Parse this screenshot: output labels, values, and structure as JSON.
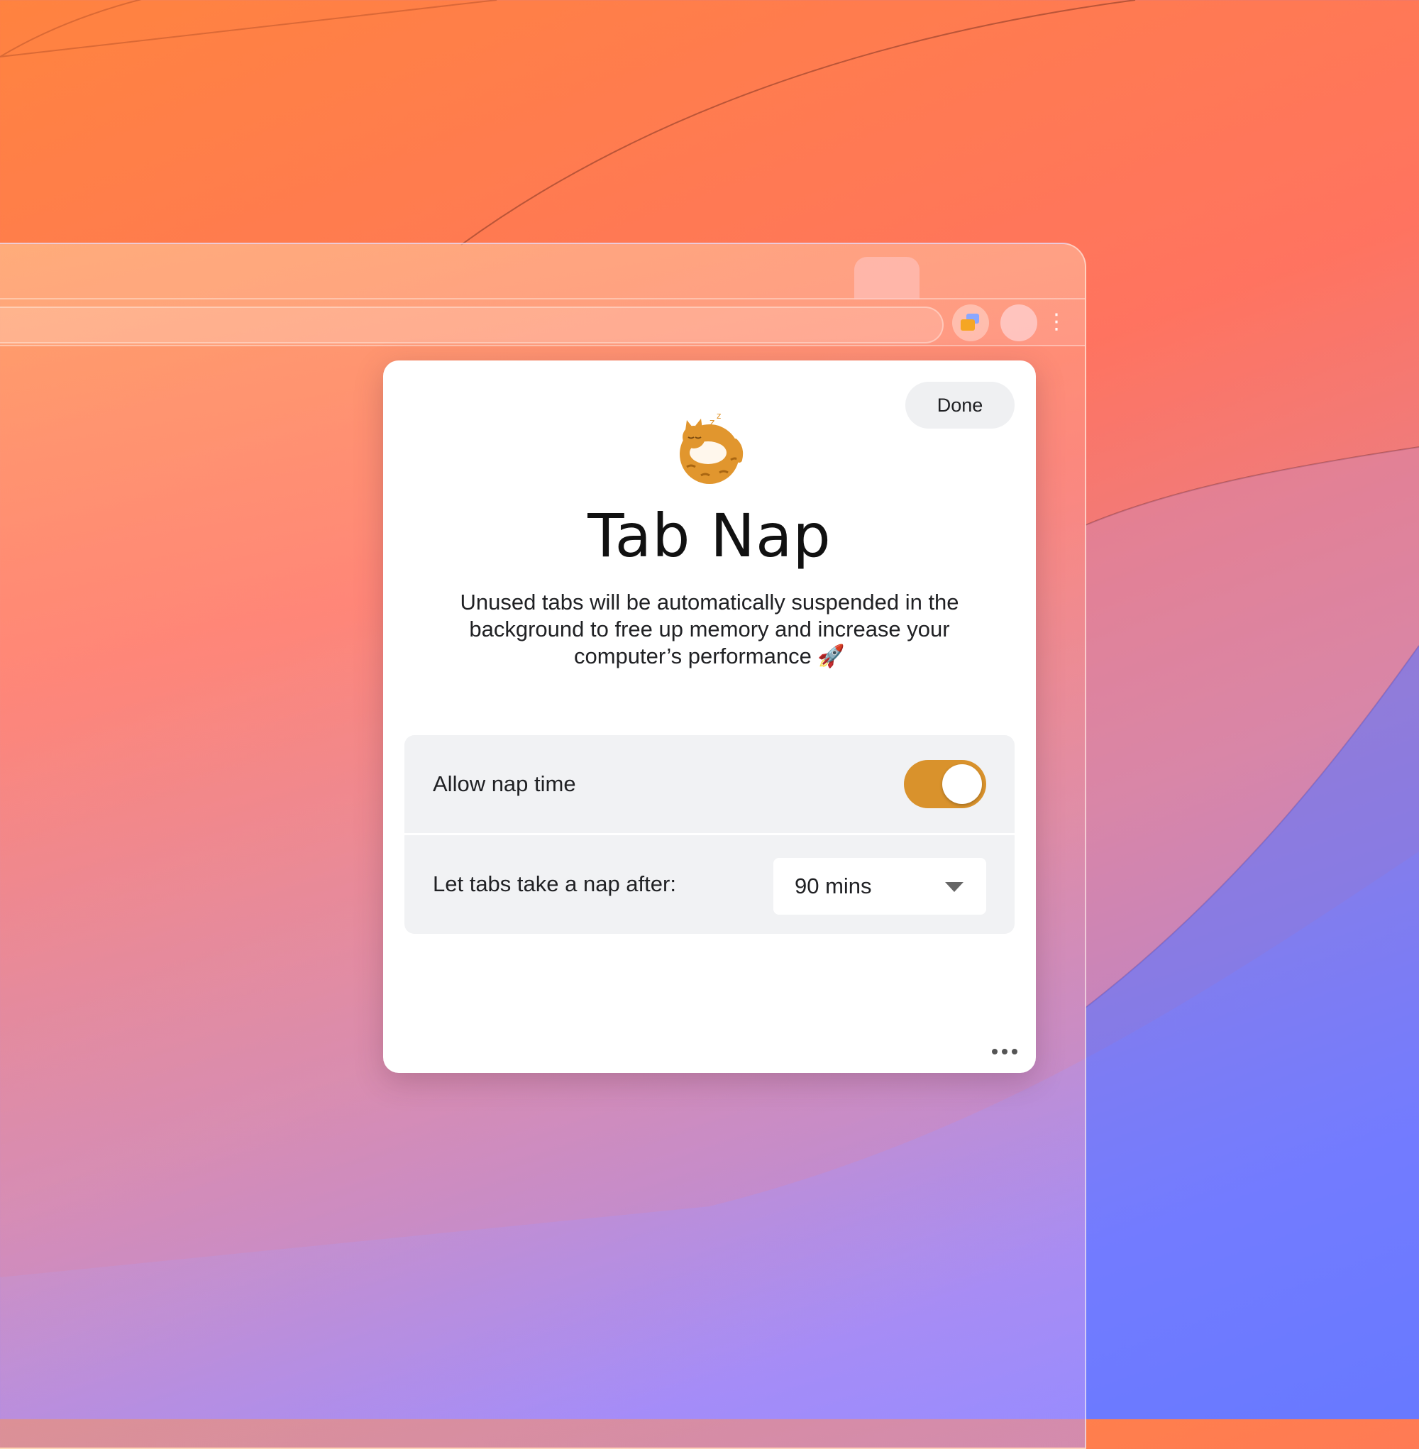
{
  "browser": {
    "extension_icon": "tab-nap-extension-icon",
    "menu_glyph": "⋮"
  },
  "popup": {
    "done_label": "Done",
    "logo_icon": "sleeping-cat-icon",
    "title": "Tab Nap",
    "description": "Unused tabs will be automatically suspended in the background to free up memory and increase your computer’s performance 🚀",
    "settings": {
      "allow_nap_label": "Allow nap time",
      "allow_nap_enabled": true,
      "nap_after_label": "Let tabs take a nap after:",
      "nap_after_value": "90 mins"
    },
    "more_icon": "more-horizontal-icon"
  },
  "colors": {
    "accent": "#d9922c",
    "panel_bg": "#f1f2f4"
  }
}
